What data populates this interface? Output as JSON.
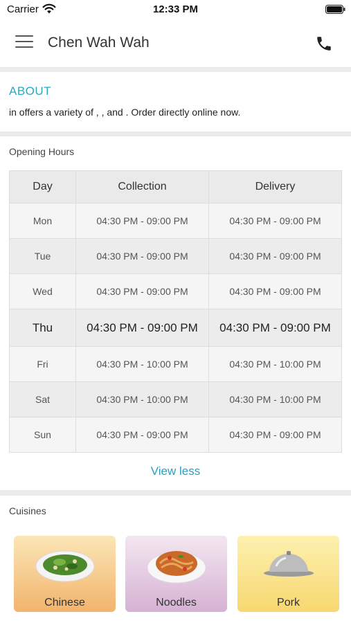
{
  "status_bar": {
    "carrier": "Carrier",
    "time": "12:33 PM"
  },
  "header": {
    "title": "Chen Wah Wah"
  },
  "about": {
    "title": "ABOUT",
    "text": "in  offers a variety of , ,  and  . Order directly online now."
  },
  "opening_hours": {
    "title": "Opening Hours",
    "columns": [
      "Day",
      "Collection",
      "Delivery"
    ],
    "rows": [
      {
        "day": "Mon",
        "collection": "04:30 PM - 09:00 PM",
        "delivery": "04:30 PM - 09:00 PM"
      },
      {
        "day": "Tue",
        "collection": "04:30 PM - 09:00 PM",
        "delivery": "04:30 PM - 09:00 PM"
      },
      {
        "day": "Wed",
        "collection": "04:30 PM - 09:00 PM",
        "delivery": "04:30 PM - 09:00 PM"
      },
      {
        "day": "Thu",
        "collection": "04:30 PM - 09:00 PM",
        "delivery": "04:30 PM - 09:00 PM"
      },
      {
        "day": "Fri",
        "collection": "04:30 PM - 10:00 PM",
        "delivery": "04:30 PM - 10:00 PM"
      },
      {
        "day": "Sat",
        "collection": "04:30 PM - 10:00 PM",
        "delivery": "04:30 PM - 10:00 PM"
      },
      {
        "day": "Sun",
        "collection": "04:30 PM - 09:00 PM",
        "delivery": "04:30 PM - 09:00 PM"
      }
    ],
    "highlighted_day": "Thu",
    "view_less_label": "View less"
  },
  "cuisines": {
    "title": "Cuisines",
    "items": [
      {
        "label": "Chinese",
        "icon": "chinese-dish-icon",
        "bg_top": "#fbe6b6",
        "bg_bottom": "#f2b46e"
      },
      {
        "label": "Noodles",
        "icon": "noodles-dish-icon",
        "bg_top": "#f3e6f0",
        "bg_bottom": "#d6b2d4"
      },
      {
        "label": "Pork",
        "icon": "cloche-icon",
        "bg_top": "#fdf1b0",
        "bg_bottom": "#f7d770"
      }
    ]
  },
  "colors": {
    "accent": "#2aa8c2",
    "link": "#2a9ec0"
  }
}
